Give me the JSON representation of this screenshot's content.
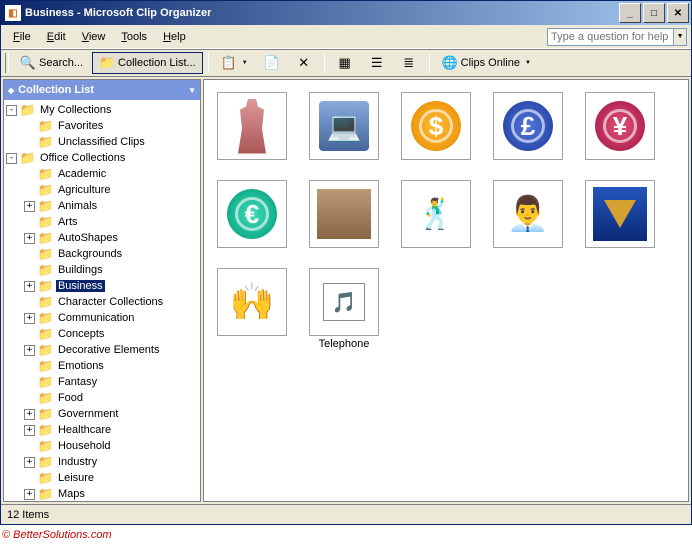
{
  "window": {
    "title": "Business - Microsoft Clip Organizer"
  },
  "menu": {
    "file": "File",
    "edit": "Edit",
    "view": "View",
    "tools": "Tools",
    "help": "Help"
  },
  "help_placeholder": "Type a question for help",
  "toolbar": {
    "search": "Search...",
    "collection_list": "Collection List...",
    "clips_online": "Clips Online"
  },
  "sidebar": {
    "title": "Collection List"
  },
  "tree": [
    {
      "level": 0,
      "exp": "-",
      "label": "My Collections"
    },
    {
      "level": 1,
      "exp": "",
      "label": "Favorites"
    },
    {
      "level": 1,
      "exp": "",
      "label": "Unclassified Clips"
    },
    {
      "level": 0,
      "exp": "-",
      "label": "Office Collections"
    },
    {
      "level": 1,
      "exp": "",
      "label": "Academic"
    },
    {
      "level": 1,
      "exp": "",
      "label": "Agriculture"
    },
    {
      "level": 1,
      "exp": "+",
      "label": "Animals"
    },
    {
      "level": 1,
      "exp": "",
      "label": "Arts"
    },
    {
      "level": 1,
      "exp": "+",
      "label": "AutoShapes"
    },
    {
      "level": 1,
      "exp": "",
      "label": "Backgrounds"
    },
    {
      "level": 1,
      "exp": "",
      "label": "Buildings"
    },
    {
      "level": 1,
      "exp": "+",
      "label": "Business",
      "selected": true
    },
    {
      "level": 1,
      "exp": "",
      "label": "Character Collections"
    },
    {
      "level": 1,
      "exp": "+",
      "label": "Communication"
    },
    {
      "level": 1,
      "exp": "",
      "label": "Concepts"
    },
    {
      "level": 1,
      "exp": "+",
      "label": "Decorative Elements"
    },
    {
      "level": 1,
      "exp": "",
      "label": "Emotions"
    },
    {
      "level": 1,
      "exp": "",
      "label": "Fantasy"
    },
    {
      "level": 1,
      "exp": "",
      "label": "Food"
    },
    {
      "level": 1,
      "exp": "+",
      "label": "Government"
    },
    {
      "level": 1,
      "exp": "+",
      "label": "Healthcare"
    },
    {
      "level": 1,
      "exp": "",
      "label": "Household"
    },
    {
      "level": 1,
      "exp": "+",
      "label": "Industry"
    },
    {
      "level": 1,
      "exp": "",
      "label": "Leisure"
    },
    {
      "level": 1,
      "exp": "+",
      "label": "Maps"
    }
  ],
  "thumbs": [
    {
      "type": "person",
      "caption": ""
    },
    {
      "type": "computer",
      "caption": ""
    },
    {
      "type": "coin-dollar",
      "caption": "",
      "glyph": "$"
    },
    {
      "type": "coin-pound",
      "caption": "",
      "glyph": "£"
    },
    {
      "type": "coin-yen",
      "caption": "",
      "glyph": "¥"
    },
    {
      "type": "coin-euro",
      "caption": "",
      "glyph": "€"
    },
    {
      "type": "meeting",
      "caption": ""
    },
    {
      "type": "dance",
      "caption": "",
      "glyph": "🕺"
    },
    {
      "type": "suit",
      "caption": "",
      "glyph": "👨‍💼"
    },
    {
      "type": "funnel",
      "caption": ""
    },
    {
      "type": "silhouette",
      "caption": "",
      "glyph": "🙌"
    },
    {
      "type": "phone-folder",
      "caption": "Telephone",
      "glyph": "🎵"
    }
  ],
  "status": "12 Items",
  "footer": "© BetterSolutions.com"
}
